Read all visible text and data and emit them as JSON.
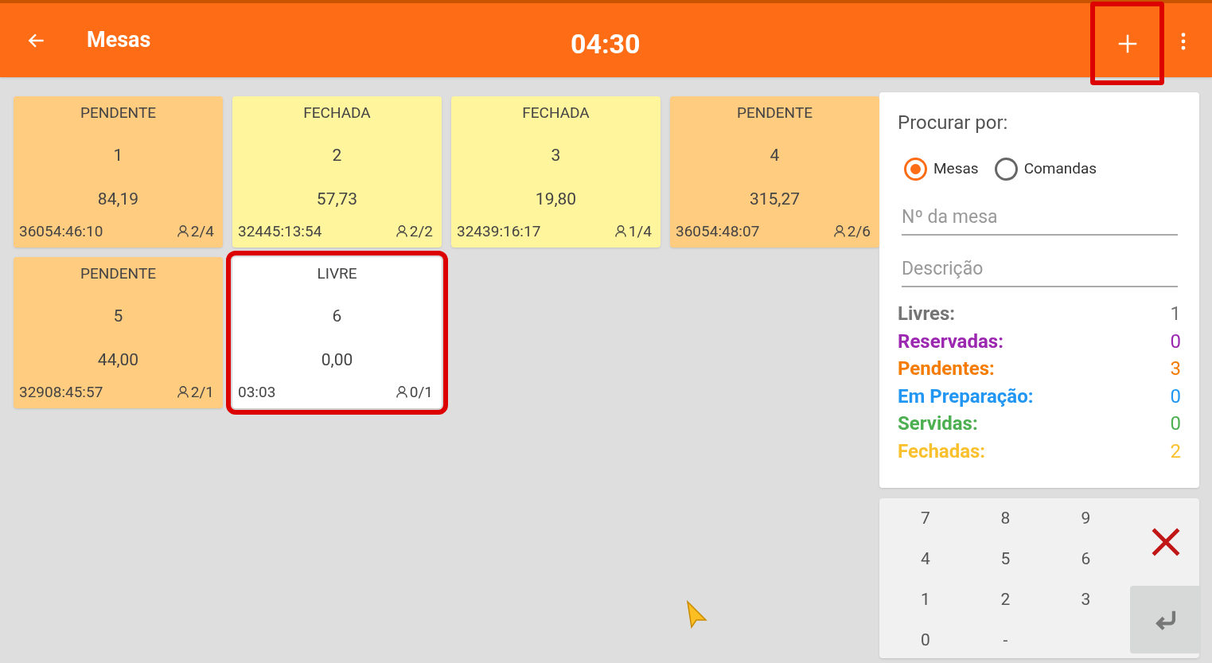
{
  "app_bar": {
    "title": "Mesas",
    "clock": "04:30",
    "add_highlighted": true
  },
  "tables": [
    {
      "status": "PENDENTE",
      "kind": "pending",
      "number": "1",
      "total": "84,19",
      "elapsed": "36054:46:10",
      "guests": "2/4",
      "highlighted": false
    },
    {
      "status": "FECHADA",
      "kind": "closed",
      "number": "2",
      "total": "57,73",
      "elapsed": "32445:13:54",
      "guests": "2/2",
      "highlighted": false
    },
    {
      "status": "FECHADA",
      "kind": "closed",
      "number": "3",
      "total": "19,80",
      "elapsed": "32439:16:17",
      "guests": "1/4",
      "highlighted": false
    },
    {
      "status": "PENDENTE",
      "kind": "pending",
      "number": "4",
      "total": "315,27",
      "elapsed": "36054:48:07",
      "guests": "2/6",
      "highlighted": false
    },
    {
      "status": "PENDENTE",
      "kind": "pending",
      "number": "5",
      "total": "44,00",
      "elapsed": "32908:45:57",
      "guests": "2/1",
      "highlighted": false
    },
    {
      "status": "LIVRE",
      "kind": "free",
      "number": "6",
      "total": "0,00",
      "elapsed": "03:03",
      "guests": "0/1",
      "highlighted": true
    }
  ],
  "search": {
    "heading": "Procurar por:",
    "options": [
      {
        "label": "Mesas",
        "selected": true
      },
      {
        "label": "Comandas",
        "selected": false
      }
    ],
    "fields": [
      {
        "placeholder": "Nº da mesa"
      },
      {
        "placeholder": "Descrição"
      }
    ]
  },
  "stats": [
    {
      "label": "Livres:",
      "value": "1",
      "color": "#757575"
    },
    {
      "label": "Reservadas:",
      "value": "0",
      "color": "#9c27b0"
    },
    {
      "label": "Pendentes:",
      "value": "3",
      "color": "#f57c00"
    },
    {
      "label": "Em Preparação:",
      "value": "0",
      "color": "#2196f3"
    },
    {
      "label": "Servidas:",
      "value": "0",
      "color": "#4caf50"
    },
    {
      "label": "Fechadas:",
      "value": "2",
      "color": "#fbc02d"
    }
  ],
  "keypad": [
    "7",
    "8",
    "9",
    "4",
    "5",
    "6",
    "1",
    "2",
    "3",
    "0",
    "-"
  ]
}
